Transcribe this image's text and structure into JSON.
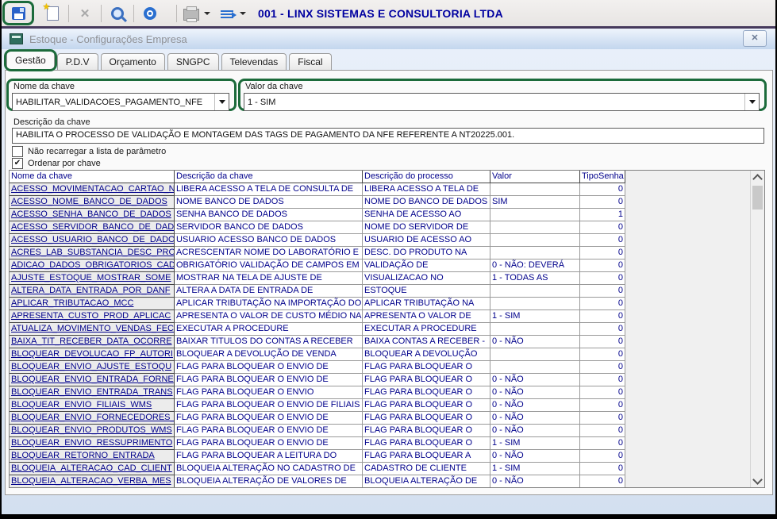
{
  "toolbar": {
    "company_title": "001 - LINX SISTEMAS E CONSULTORIA LTDA",
    "icons": [
      "save-icon",
      "new-document-icon",
      "delete-icon",
      "search-icon",
      "power-icon",
      "print-icon",
      "export-list-icon"
    ]
  },
  "window": {
    "title": "Estoque - Configurações Empresa",
    "close_glyph": "✕"
  },
  "tabs": [
    {
      "label": "Gestão",
      "selected": true
    },
    {
      "label": "P.D.V",
      "selected": false
    },
    {
      "label": "Orçamento",
      "selected": false
    },
    {
      "label": "SNGPC",
      "selected": false
    },
    {
      "label": "Televendas",
      "selected": false
    },
    {
      "label": "Fiscal",
      "selected": false
    }
  ],
  "fields": {
    "nome_da_chave": {
      "label": "Nome da chave",
      "value": "HABILITAR_VALIDACOES_PAGAMENTO_NFE"
    },
    "valor_da_chave": {
      "label": "Valor da chave",
      "value": "1 - SIM"
    },
    "descricao_da_chave": {
      "label": "Descrição da chave",
      "value": "HABILITA O PROCESSO DE VALIDAÇÃO E MONTAGEM DAS TAGS DE PAGAMENTO DA NFE REFERENTE A NT20225.001."
    }
  },
  "checkboxes": [
    {
      "label": "Não recarregar a lista de parâmetro",
      "checked": false
    },
    {
      "label": "Ordenar por chave",
      "checked": true,
      "check_glyph": "✔"
    }
  ],
  "table": {
    "columns": [
      "Nome da chave",
      "Descrição  da chave",
      "Descrição do processo",
      "Valor",
      "TipoSenha"
    ],
    "col_keys": [
      "nome-da-chave",
      "descricao-da-chave",
      "descricao-do-processo",
      "valor",
      "tipo-senha"
    ],
    "rows": [
      [
        "ACESSO_MOVIMENTACAO_CARTAO_N",
        "LIBERA ACESSO A TELA DE CONSULTA DE",
        "LIBERA ACESSO A TELA DE",
        "",
        "0"
      ],
      [
        "ACESSO_NOME_BANCO_DE_DADOS",
        "NOME BANCO DE DADOS",
        "NOME DO BANCO DE DADOS",
        "SIM",
        "0"
      ],
      [
        "ACESSO_SENHA_BANCO_DE_DADOS",
        "SENHA BANCO DE DADOS",
        "SENHA DE ACESSO AO",
        "",
        "1"
      ],
      [
        "ACESSO_SERVIDOR_BANCO_DE_DADO",
        "SERVIDOR BANCO DE DADOS",
        "NOME DO SERVIDOR DE",
        "",
        "0"
      ],
      [
        "ACESSO_USUARIO_BANCO_DE_DADO",
        "USUARIO ACESSO BANCO DE DADOS",
        "USUARIO DE ACESSO AO",
        "",
        "0"
      ],
      [
        "ACRES_LAB_SUBSTANCIA_DESC_PRO",
        "ACRESCENTAR NOME DO LABORATÓRIO E",
        "DESC. DO PRODUTO NA",
        "",
        "0"
      ],
      [
        "ADICAO_DADOS_OBRIGATORIOS_CAD",
        "OBRIGATÓRIO VALIDAÇÃO DE CAMPOS EM",
        "VALIDAÇÃO DE",
        "0 - NÃO: DEVERÁ",
        "0"
      ],
      [
        "AJUSTE_ESTOQUE_MOSTRAR_SOME",
        "MOSTRAR NA TELA DE AJUSTE DE",
        "VISUALIZACAO NO",
        "1 - TODAS AS",
        "0"
      ],
      [
        "ALTERA_DATA_ENTRADA_POR_DANF",
        "ALTERA A DATA DE ENTRADA DE",
        "ESTOQUE",
        "",
        "0"
      ],
      [
        "APLICAR_TRIBUTACAO_MCC",
        "APLICAR TRIBUTAÇÃO NA IMPORTAÇÃO DO",
        "APLICAR TRIBUTAÇÃO NA",
        "",
        "0"
      ],
      [
        "APRESENTA_CUSTO_PROD_APLICAC",
        "APRESENTA O VALOR DE CUSTO MÉDIO NA",
        "APRESENTA O VALOR DE",
        "1 - SIM",
        "0"
      ],
      [
        "ATUALIZA_MOVIMENTO_VENDAS_FEC",
        "EXECUTAR A PROCEDURE",
        "EXECUTAR A PROCEDURE",
        "",
        "0"
      ],
      [
        "BAIXA_TIT_RECEBER_DATA_OCORRE",
        "BAIXAR TITULOS DO CONTAS A RECEBER",
        "BAIXA CONTAS A RECEBER -",
        "0 - NÃO",
        "0"
      ],
      [
        "BLOQUEAR_DEVOLUCAO_FP_AUTORI",
        "BLOQUEAR A DEVOLUÇÃO DE VENDA",
        "BLOQUEAR A DEVOLUÇÃO",
        "",
        "0"
      ],
      [
        "BLOQUEAR_ENVIO_AJUSTE_ESTOQU",
        "FLAG PARA BLOQUEAR O ENVIO DE",
        "FLAG PARA BLOQUEAR O",
        "",
        "0"
      ],
      [
        "BLOQUEAR_ENVIO_ENTRADA_FORNE",
        "FLAG PARA BLOQUEAR O ENVIO DE",
        "FLAG PARA BLOQUEAR O",
        "0 - NÃO",
        "0"
      ],
      [
        "BLOQUEAR_ENVIO_ENTRADA_TRANS",
        "FLAG PARA BLOQUEAR O ENVIO",
        "FLAG PARA BLOQUEAR O",
        "0 - NÃO",
        "0"
      ],
      [
        "BLOQUEAR_ENVIO_FILIAIS_WMS",
        "FLAG PARA BLOQUEAR O ENVIO DE FILIAIS",
        "FLAG PARA BLOQUEAR O",
        "0 - NÃO",
        "0"
      ],
      [
        "BLOQUEAR_ENVIO_FORNECEDORES_",
        "FLAG PARA BLOQUEAR O ENVIO DE",
        "FLAG PARA BLOQUEAR O",
        "0 - NÃO",
        "0"
      ],
      [
        "BLOQUEAR_ENVIO_PRODUTOS_WMS",
        "FLAG PARA BLOQUEAR O ENVIO DE",
        "FLAG PARA BLOQUEAR O",
        "0 - NÃO",
        "0"
      ],
      [
        "BLOQUEAR_ENVIO_RESSUPRIMENTO",
        "FLAG PARA BLOQUEAR O ENVIO DE",
        "FLAG PARA BLOQUEAR O",
        "1 - SIM",
        "0"
      ],
      [
        "BLOQUEAR_RETORNO_ENTRADA",
        "FLAG PARA BLOQUEAR A LEITURA DO",
        "FLAG PARA BLOQUEAR A",
        "0 - NÃO",
        "0"
      ],
      [
        "BLOQUEIA_ALTERACAO_CAD_CLIENT",
        "BLOQUEIA ALTERAÇÃO NO CADASTRO DE",
        "CADASTRO DE CLIENTE",
        "1 - SIM",
        "0"
      ],
      [
        "BLOQUEIA_ALTERACAO_VERBA_MES",
        "BLOQUEIA ALTERAÇÃO DE VALORES DE",
        "BLOQUEIA ALTERAÇÃO DE",
        "0 - NÃO",
        "0"
      ]
    ]
  },
  "colors": {
    "highlight_green": "#1c6b3b",
    "grid_text_navy": "#00008b",
    "toolbar_title_blue": "#0000a0",
    "purple_divider": "#46395c"
  }
}
